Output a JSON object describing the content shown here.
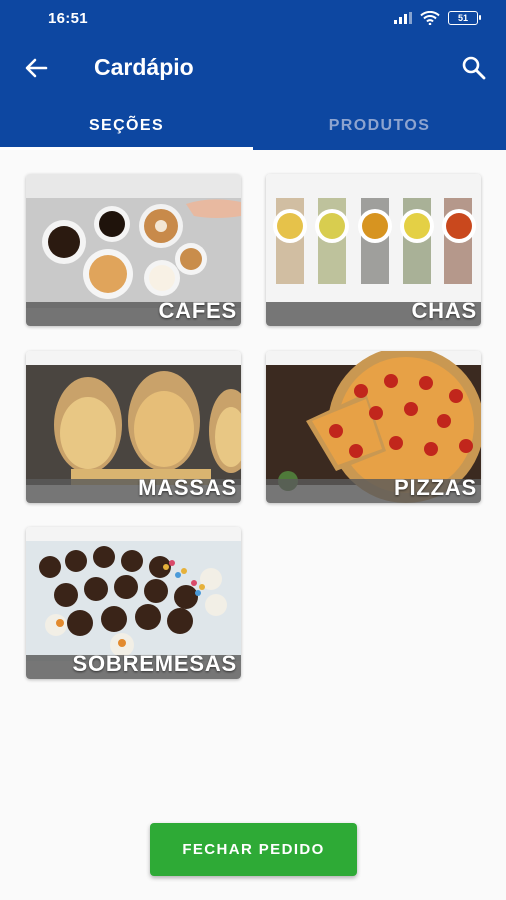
{
  "status_bar": {
    "time": "16:51",
    "battery": "51"
  },
  "toolbar": {
    "title": "Cardápio",
    "back_icon": "arrow-left-icon",
    "search_icon": "search-icon"
  },
  "tabs": [
    {
      "label": "SEÇÕES",
      "active": true
    },
    {
      "label": "PRODUTOS",
      "active": false
    }
  ],
  "sections": [
    {
      "label": "CAFES"
    },
    {
      "label": "CHAS"
    },
    {
      "label": "MASSAS"
    },
    {
      "label": "PIZZAS"
    },
    {
      "label": "SOBREMESAS"
    }
  ],
  "footer": {
    "button_label": "FECHAR PEDIDO"
  },
  "colors": {
    "primary": "#0d47a1",
    "accent": "#2eaa36",
    "tab_inactive": "#8ea4cf"
  }
}
